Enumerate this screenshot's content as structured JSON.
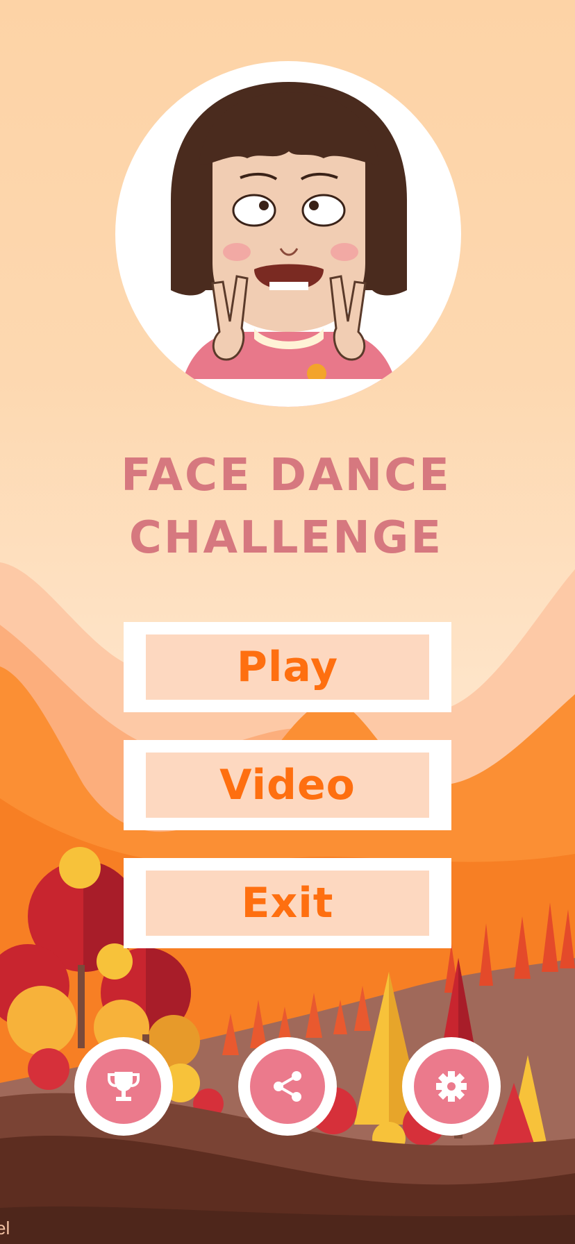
{
  "game": {
    "title_line1": "FACE DANCE",
    "title_line2": "CHALLENGE"
  },
  "menu": {
    "play_label": "Play",
    "video_label": "Video",
    "exit_label": "Exit"
  },
  "icons": {
    "trophy": "trophy-icon",
    "share": "share-icon",
    "settings": "gear-icon"
  },
  "watermark": "el",
  "colors": {
    "title": "#d6787f",
    "button_text": "#fe6f10",
    "button_fill": "#fdd8c0",
    "icon_disc": "#eb7a8c"
  }
}
